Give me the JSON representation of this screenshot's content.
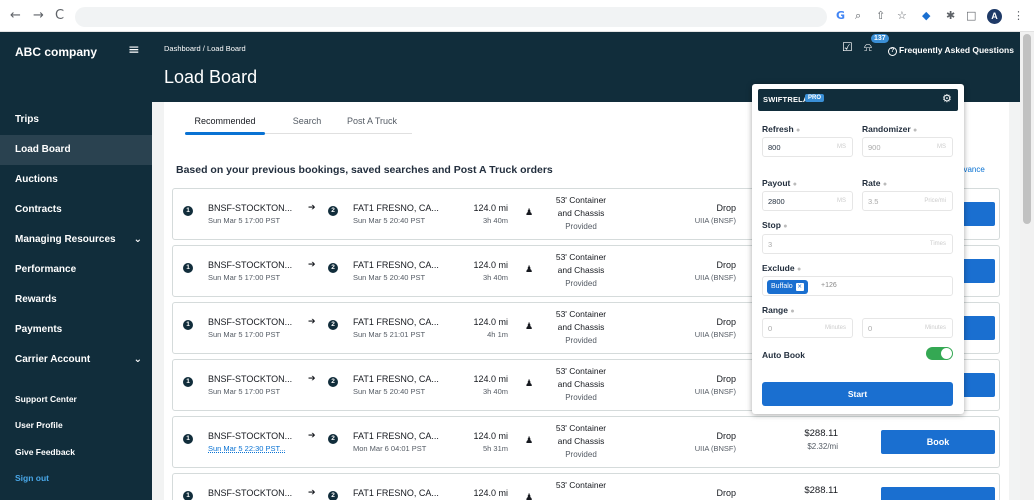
{
  "browser": {
    "back_icon": "←",
    "forward_icon": "→",
    "reload_icon": "C",
    "right_icons": [
      "G",
      "⌕",
      "⇧",
      "☆",
      "◆",
      "✱",
      "□"
    ],
    "profile_initial": "A",
    "menu_icon": "⋮"
  },
  "sidebar": {
    "brand": "ABC company",
    "menu_icon": "≡",
    "items": [
      {
        "label": "Trips",
        "active": false
      },
      {
        "label": "Load Board",
        "active": true
      },
      {
        "label": "Auctions",
        "active": false
      },
      {
        "label": "Contracts",
        "active": false
      },
      {
        "label": "Managing Resources",
        "active": false,
        "chevron": "⌄"
      },
      {
        "label": "Performance",
        "active": false
      },
      {
        "label": "Rewards",
        "active": false
      },
      {
        "label": "Payments",
        "active": false
      },
      {
        "label": "Carrier Account",
        "active": false,
        "chevron": "⌄"
      }
    ],
    "footer_links": [
      "Support Center",
      "User Profile",
      "Give Feedback",
      "Sign out"
    ]
  },
  "header": {
    "breadcrumb": "Dashboard  /  Load Board",
    "title": "Load Board",
    "notification_count": "137",
    "faq_label": "Frequently Asked Questions",
    "faq_icon": "?",
    "checkbox_icon": "☑",
    "bell_icon": "⍾"
  },
  "tabs": [
    "Recommended",
    "Search",
    "Post A Truck"
  ],
  "section": {
    "heading": "Based on your previous bookings, saved searches and Post A Truck orders",
    "sort_partial": "evance"
  },
  "loads": [
    {
      "origin": "BNSF-STOCKTON...",
      "origin_time": "Sun Mar 5 17:00 PST",
      "dest": "FAT1 FRESNO, CA...",
      "dest_time": "Sun Mar 5 20:40 PST",
      "distance": "124.0 mi",
      "duration": "3h 40m",
      "equipment1": "53' Container",
      "equipment2": "and Chassis",
      "equipment3": "Provided",
      "drop": "Drop",
      "facility": "UIIA (BNSF)",
      "price": "",
      "rate": "",
      "book": ""
    },
    {
      "origin": "BNSF-STOCKTON...",
      "origin_time": "Sun Mar 5 17:00 PST",
      "dest": "FAT1 FRESNO, CA...",
      "dest_time": "Sun Mar 5 20:40 PST",
      "distance": "124.0 mi",
      "duration": "3h 40m",
      "equipment1": "53' Container",
      "equipment2": "and Chassis",
      "equipment3": "Provided",
      "drop": "Drop",
      "facility": "UIIA (BNSF)",
      "price": "",
      "rate": "",
      "book": ""
    },
    {
      "origin": "BNSF-STOCKTON...",
      "origin_time": "Sun Mar 5 17:00 PST",
      "dest": "FAT1 FRESNO, CA...",
      "dest_time": "Sun Mar 5 21:01 PST",
      "distance": "124.0 mi",
      "duration": "4h 1m",
      "equipment1": "53' Container",
      "equipment2": "and Chassis",
      "equipment3": "Provided",
      "drop": "Drop",
      "facility": "UIIA (BNSF)",
      "price": "",
      "rate": "",
      "book": ""
    },
    {
      "origin": "BNSF-STOCKTON...",
      "origin_time": "Sun Mar 5 17:00 PST",
      "dest": "FAT1 FRESNO, CA...",
      "dest_time": "Sun Mar 5 20:40 PST",
      "distance": "124.0 mi",
      "duration": "3h 40m",
      "equipment1": "53' Container",
      "equipment2": "and Chassis",
      "equipment3": "Provided",
      "drop": "Drop",
      "facility": "UIIA (BNSF)",
      "price": "",
      "rate": "",
      "book": ""
    },
    {
      "origin": "BNSF-STOCKTON...",
      "origin_time": "Sun Mar 5 22:30 PST...",
      "dest": "FAT1 FRESNO, CA...",
      "dest_time": "Mon Mar 6 04:01 PST",
      "distance": "124.0 mi",
      "duration": "5h 31m",
      "equipment1": "53' Container",
      "equipment2": "and Chassis",
      "equipment3": "Provided",
      "drop": "Drop",
      "facility": "UIIA (BNSF)",
      "price": "$288.11",
      "rate": "$2.32/mi",
      "book": "Book"
    },
    {
      "origin": "BNSF-STOCKTON...",
      "origin_time": "",
      "dest": "FAT1 FRESNO, CA...",
      "dest_time": "",
      "distance": "124.0 mi",
      "duration": "",
      "equipment1": "53' Container",
      "equipment2": "",
      "equipment3": "",
      "drop": "Drop",
      "facility": "",
      "price": "$288.11",
      "rate": "",
      "book": ""
    }
  ],
  "stop_numbers": [
    "1",
    "2"
  ],
  "arrow_icon": "➔",
  "person_icon": "♟",
  "extension": {
    "title": "SWIFTRELAY",
    "badge": "PRO",
    "gear_icon": "⚙",
    "info_icon": "●",
    "refresh": {
      "label": "Refresh",
      "value": "800",
      "unit": "MS"
    },
    "randomizer": {
      "label": "Randomizer",
      "value": "900",
      "unit": "MS"
    },
    "payout": {
      "label": "Payout",
      "value": "2800",
      "unit": "MS"
    },
    "rate": {
      "label": "Rate",
      "value": "3.5",
      "unit": "Price/mi"
    },
    "stop": {
      "label": "Stop",
      "value": "3",
      "unit": "Times"
    },
    "exclude": {
      "label": "Exclude",
      "chip": "Buffalo",
      "chip_close": "×",
      "more": "+126"
    },
    "range": {
      "label": "Range",
      "min": "0",
      "min_unit": "Minutes",
      "max": "0",
      "max_unit": "Minutes"
    },
    "auto_book": {
      "label": "Auto Book",
      "enabled": true
    },
    "start_label": "Start"
  },
  "colors": {
    "nav_dark": "#112d3b",
    "accent_blue": "#1a6fd0",
    "toggle_green": "#34a853"
  }
}
